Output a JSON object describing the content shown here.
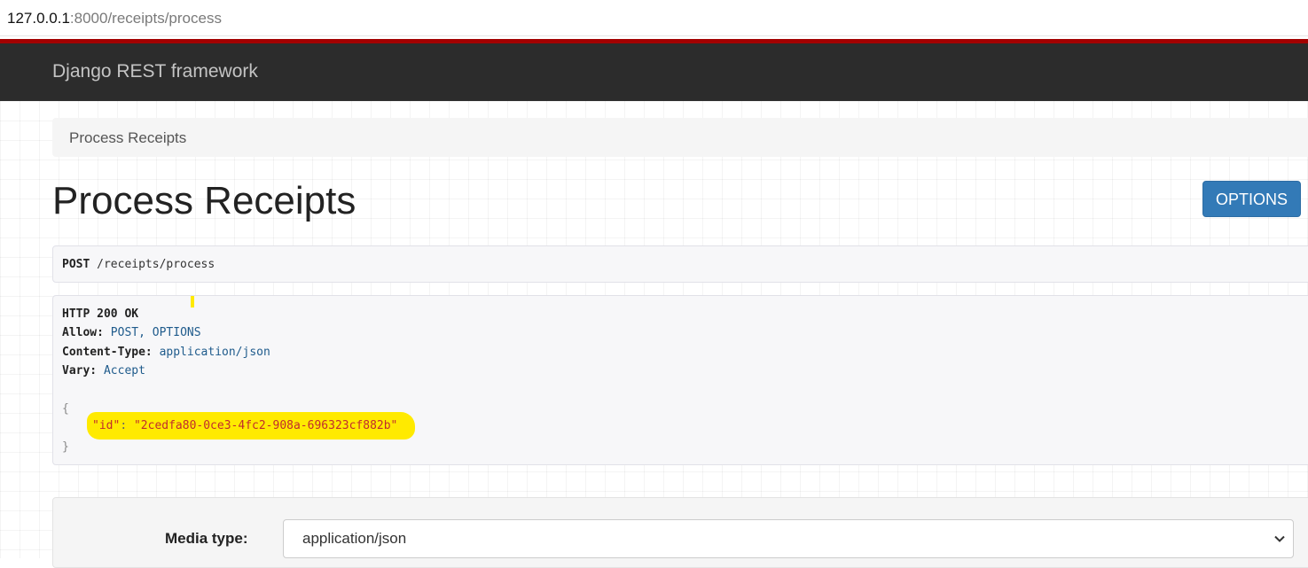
{
  "browser": {
    "url_host": "127.0.0.1",
    "url_rest": ":8000/receipts/process"
  },
  "navbar": {
    "brand": "Django REST framework"
  },
  "breadcrumb": {
    "items": [
      {
        "label": "Process Receipts"
      }
    ]
  },
  "page": {
    "title": "Process Receipts",
    "options_button": "OPTIONS"
  },
  "request": {
    "method": "POST",
    "path": "/receipts/process"
  },
  "response": {
    "status": "HTTP 200 OK",
    "headers": [
      {
        "name": "Allow:",
        "value": "POST, OPTIONS"
      },
      {
        "name": "Content-Type:",
        "value": "application/json"
      },
      {
        "name": "Vary:",
        "value": "Accept"
      }
    ],
    "body_open": "{",
    "body_key": "\"id\"",
    "body_colon": ":",
    "body_value": "\"2cedfa80-0ce3-4fc2-908a-696323cf882b\"",
    "body_close": "}"
  },
  "form": {
    "media_type_label": "Media type:",
    "media_type_value": "application/json"
  },
  "colors": {
    "navbar_bg": "#2c2c2c",
    "accent_stripe": "#a30000",
    "primary_button": "#337ab7",
    "highlight": "#ffea00"
  },
  "icons": {
    "select_arrow": "chevron-down-icon"
  }
}
